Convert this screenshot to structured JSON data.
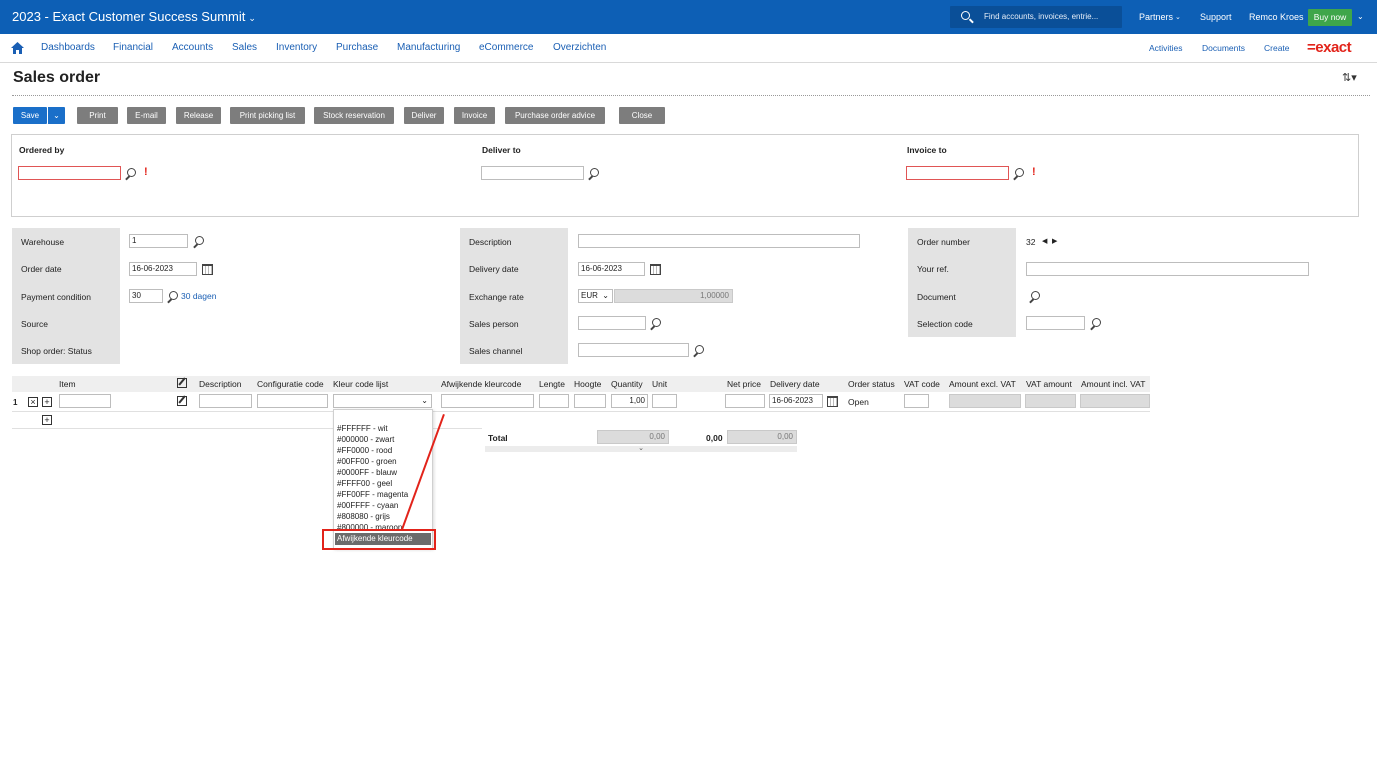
{
  "topbar": {
    "title": "2023 - Exact Customer Success Summit",
    "search_placeholder": "Find accounts, invoices, entrie...",
    "partners": "Partners",
    "support": "Support",
    "user": "Remco Kroes",
    "buy_now": "Buy now"
  },
  "menu": {
    "items": [
      "Dashboards",
      "Financial",
      "Accounts",
      "Sales",
      "Inventory",
      "Purchase",
      "Manufacturing",
      "eCommerce",
      "Overzichten"
    ],
    "right": [
      "Activities",
      "Documents",
      "Create"
    ],
    "logo": "=exact"
  },
  "page": {
    "title": "Sales order"
  },
  "toolbar": {
    "save": "Save",
    "print": "Print",
    "email": "E-mail",
    "release": "Release",
    "print_picking": "Print picking list",
    "stock_reservation": "Stock reservation",
    "deliver": "Deliver",
    "invoice": "Invoice",
    "purchase_advice": "Purchase order advice",
    "close": "Close"
  },
  "address": {
    "ordered_by": "Ordered by",
    "deliver_to": "Deliver to",
    "invoice_to": "Invoice to"
  },
  "left_panel": {
    "warehouse_label": "Warehouse",
    "warehouse_value": "1",
    "order_date_label": "Order date",
    "order_date_value": "16-06-2023",
    "payment_label": "Payment condition",
    "payment_value": "30",
    "payment_link": "30 dagen",
    "source_label": "Source",
    "shop_status_label": "Shop order: Status"
  },
  "mid_panel": {
    "description_label": "Description",
    "delivery_date_label": "Delivery date",
    "delivery_date_value": "16-06-2023",
    "exchange_label": "Exchange rate",
    "currency": "EUR",
    "rate": "1,00000",
    "sales_person_label": "Sales person",
    "sales_channel_label": "Sales channel"
  },
  "right_panel": {
    "order_number_label": "Order number",
    "order_number_value": "32",
    "your_ref_label": "Your ref.",
    "document_label": "Document",
    "selection_code_label": "Selection code"
  },
  "grid": {
    "headers": {
      "item": "Item",
      "description": "Description",
      "config_code": "Configuratie code",
      "color_list": "Kleur code lijst",
      "custom_color": "Afwijkende kleurcode",
      "length": "Lengte",
      "height": "Hoogte",
      "quantity": "Quantity",
      "unit": "Unit",
      "net_price": "Net price",
      "delivery_date": "Delivery date",
      "order_status": "Order status",
      "vat_code": "VAT code",
      "amount_excl": "Amount excl. VAT",
      "vat_amount": "VAT amount",
      "amount_incl": "Amount incl. VAT"
    },
    "row": {
      "number": "1",
      "quantity": "1,00",
      "delivery_date": "16-06-2023",
      "status": "Open"
    }
  },
  "dropdown": {
    "options": [
      "#FFFFFF - wit",
      "#000000 - zwart",
      "#FF0000 - rood",
      "#00FF00 - groen",
      "#0000FF - blauw",
      "#FFFF00 - geel",
      "#FF00FF - magenta",
      "#00FFFF - cyaan",
      "#808080 - grijs",
      "#800000 - maroon"
    ],
    "selected": "Afwijkende kleurcode"
  },
  "totals": {
    "label": "Total",
    "excl": "0,00",
    "vat": "0,00",
    "incl": "0,00"
  }
}
